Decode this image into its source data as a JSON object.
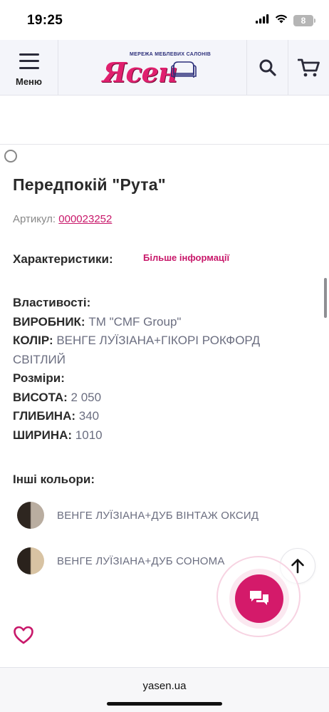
{
  "status_bar": {
    "time": "19:25",
    "battery": "8",
    "signal_icon": "cellular-signal-icon",
    "wifi_icon": "wifi-icon"
  },
  "header": {
    "menu_label": "Меню",
    "logo_text": "Ясен",
    "logo_tagline": "МЕРЕЖА МЕБЛЕВИХ САЛОНІВ",
    "search_icon": "search-icon",
    "cart_icon": "cart-icon",
    "menu_icon": "hamburger-icon"
  },
  "product": {
    "title": "Передпокій \"Рута\"",
    "sku_label": "Артикул: ",
    "sku_value": "000023252",
    "characteristics_label": "Характеристики:",
    "more_info_link": "Більше інформації"
  },
  "properties": {
    "heading": "Властивості:",
    "manufacturer_key": "ВИРОБНИК:",
    "manufacturer_value": " ТМ \"CMF Group\"",
    "color_key": "КОЛІР:",
    "color_value": " ВЕНГЕ ЛУЇЗІАНА+ГІКОРІ РОКФОРД СВІТЛИЙ",
    "sizes_heading": "Розміри:",
    "height_key": "ВИСОТА:",
    "height_value": " 2 050",
    "depth_key": "ГЛИБИНА:",
    "depth_value": " 340",
    "width_key": "ШИРИНА:",
    "width_value": " 1010"
  },
  "other_colors": {
    "label": "Інші кольори:",
    "items": [
      {
        "name": "ВЕНГЕ ЛУЇЗІАНА+ДУБ ВІНТАЖ ОКСИД",
        "swatch_colors": [
          "#2e2620",
          "#b9ada0"
        ]
      },
      {
        "name": "ВЕНГЕ ЛУЇЗІАНА+ДУБ СОНОМА",
        "swatch_colors": [
          "#2a221c",
          "#d8c3a3"
        ]
      }
    ]
  },
  "accent_color": "#d41a6a",
  "browser": {
    "url": "yasen.ua"
  }
}
